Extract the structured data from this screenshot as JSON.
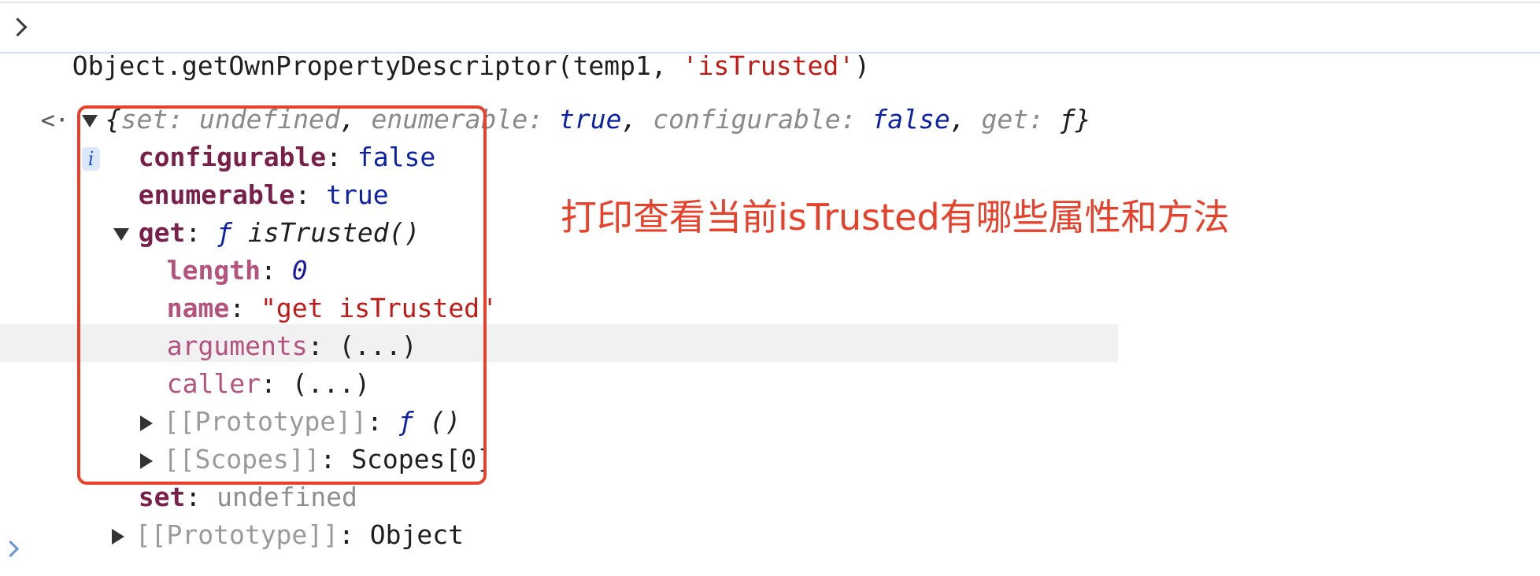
{
  "console": {
    "command": {
      "prefix": "Object.getOwnPropertyDescriptor(temp1, ",
      "arg": "'isTrusted'",
      "suffix": ")"
    },
    "summary": {
      "open": "{",
      "k1": "set",
      "v1": "undefined",
      "k2": "enumerable",
      "v2": "true",
      "k3": "configurable",
      "v3": "false",
      "k4": "get",
      "v4": "ƒ",
      "close": "}",
      "info": "i"
    },
    "props": {
      "configurable_key": "configurable",
      "configurable_val": "false",
      "enumerable_key": "enumerable",
      "enumerable_val": "true",
      "get_key": "get",
      "get_f": "ƒ",
      "get_sig": "isTrusted()",
      "length_key": "length",
      "length_val": "0",
      "name_key": "name",
      "name_val": "\"get isTrusted\"",
      "arguments_key": "arguments",
      "arguments_val": "(...)",
      "caller_key": "caller",
      "caller_val": "(...)",
      "proto_key": "[[Prototype]]",
      "proto_f": "ƒ",
      "proto_val": "()",
      "scopes_key": "[[Scopes]]",
      "scopes_val": "Scopes[0]",
      "set_key": "set",
      "set_val": "undefined",
      "obj_proto_key": "[[Prototype]]",
      "obj_proto_val": "Object"
    }
  },
  "annotation": "打印查看当前isTrusted有哪些属性和方法",
  "colors": {
    "annotation_red": "#e8412b",
    "string_red": "#c41a16",
    "keyword_blue": "#0d22aa"
  }
}
